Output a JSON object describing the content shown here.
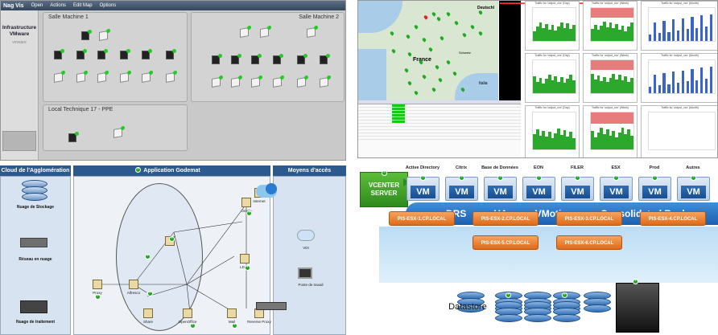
{
  "nagvis": {
    "logo": "Nag Vis",
    "menu": [
      "Open",
      "Actions",
      "Edit Map",
      "Options"
    ],
    "side_title": "Infrastructure VMware",
    "side_sub": "vmware",
    "panels": [
      {
        "title": "Salle Machine 1"
      },
      {
        "title": "Salle Machine 2"
      },
      {
        "title": "Local Technique 17 - PPE"
      }
    ]
  },
  "monitor": {
    "map_labels": [
      "Deutschl",
      "France",
      "Schweiz",
      "Italia"
    ],
    "graph_titles": [
      "Traffic for 'output_xxx' (Day)",
      "Traffic for 'output_xxx' (Week)",
      "Traffic for 'output_xxx' (Month)"
    ]
  },
  "godemat": {
    "col_left": "Cloud de l'Agglomération",
    "col_mid": "Application Godemat",
    "col_right": "Moyens d'accès",
    "left_items": [
      "Nuage de Stockage",
      "Réseau en nuage",
      "Nuage de traitement"
    ],
    "nodes": [
      "Proxy",
      "Alfresco",
      "Share",
      "OpenOffice",
      "Mail",
      "Oracle",
      "LDAP",
      "Internet",
      "Reverse Proxy"
    ],
    "right_items": [
      "VDI",
      "Poste de travail"
    ]
  },
  "vmware": {
    "vcenter": "VCENTER SERVER",
    "vm_labels": [
      "Active Directory",
      "Citrix",
      "Base de Données",
      "EON",
      "FILER",
      "ESX",
      "Prod",
      "Autres"
    ],
    "vm": "VM",
    "bar": [
      "DRS",
      "HA",
      "VMotion",
      "Consolidated Backup"
    ],
    "hosts": [
      "PIS-ESX-1.CP.LOCAL",
      "PIS-ESX-2.CP.LOCAL",
      "PIS-ESX-3.CP.LOCAL",
      "PIS-ESX-4.CP.LOCAL",
      "PIS-ESX-5.CP.LOCAL",
      "PIS-ESX-6.CP.LOCAL"
    ],
    "datastore": "Datastore"
  }
}
